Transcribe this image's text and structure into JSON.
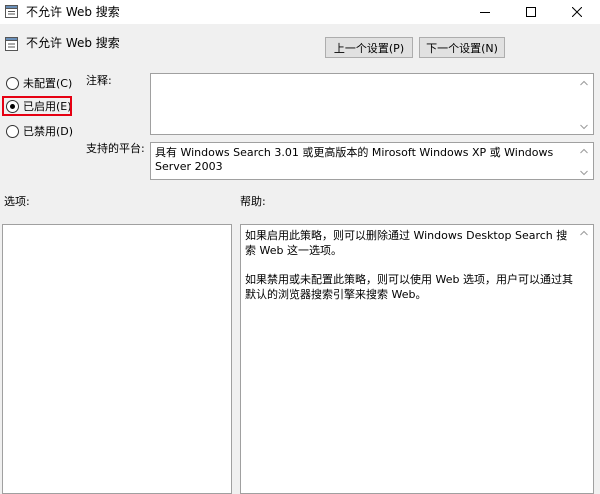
{
  "window": {
    "title": "不允许 Web 搜索",
    "minimize_icon": "minimize-icon",
    "maximize_icon": "maximize-icon",
    "close_icon": "close-icon"
  },
  "header": {
    "policy_title": "不允许 Web 搜索",
    "prev_button": "上一个设置(P)",
    "next_button": "下一个设置(N)"
  },
  "state_options": {
    "not_configured": "未配置(C)",
    "enabled": "已启用(E)",
    "disabled": "已禁用(D)",
    "selected": "enabled"
  },
  "comment": {
    "label": "注释:",
    "value": ""
  },
  "supported_on": {
    "label": "支持的平台:",
    "value": "具有 Windows Search 3.01 或更高版本的 Mirosoft Windows XP 或 Windows Server 2003"
  },
  "options_pane": {
    "label": "选项:"
  },
  "help_pane": {
    "label": "帮助:",
    "paragraphs": [
      "如果启用此策略，则可以删除通过 Windows Desktop Search 搜索 Web 这一选项。",
      "如果禁用或未配置此策略，则可以使用 Web 选项，用户可以通过其默认的浏览器搜索引擎来搜索 Web。"
    ]
  },
  "colors": {
    "highlight_border": "#e60012",
    "window_bg": "#f0f0f0"
  }
}
